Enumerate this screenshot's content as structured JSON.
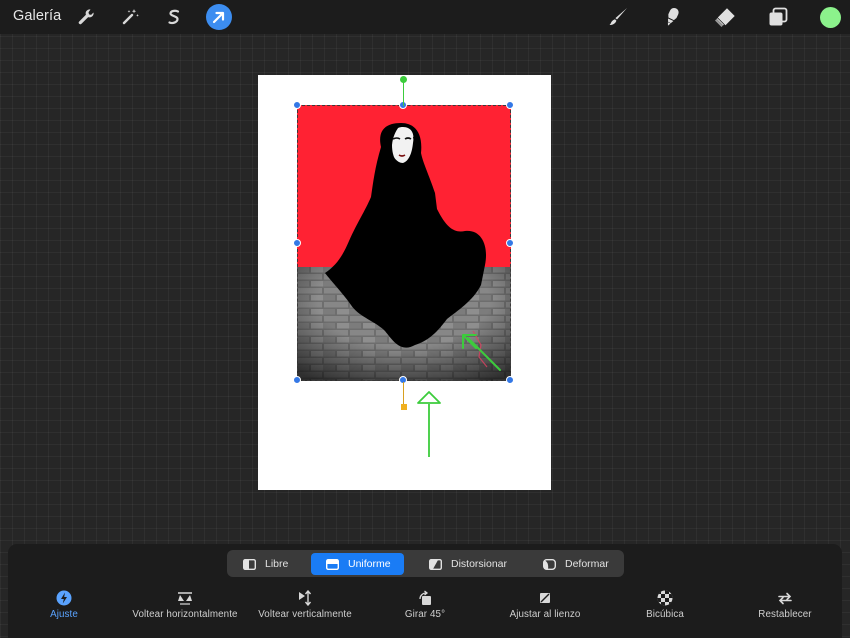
{
  "app": {
    "gallery_label": "Galería"
  },
  "toolbar_left": [
    {
      "name": "actions-wrench-icon"
    },
    {
      "name": "adjustments-magic-wand-icon"
    },
    {
      "name": "selection-icon"
    },
    {
      "name": "transform-arrow-icon",
      "active": true
    }
  ],
  "toolbar_right": [
    {
      "name": "brush-icon"
    },
    {
      "name": "smudge-icon"
    },
    {
      "name": "eraser-icon"
    },
    {
      "name": "layers-icon"
    }
  ],
  "colors": {
    "accent": "#1a7cf5",
    "current_color": "#8cf28c",
    "background_red": "#ff2233",
    "annotation_green": "#3ccc3c",
    "pivot_orange": "#f0b020"
  },
  "transform_modes": [
    {
      "label": "Libre",
      "icon": "freeform-icon",
      "active": false
    },
    {
      "label": "Uniforme",
      "icon": "uniform-icon",
      "active": true
    },
    {
      "label": "Distorsionar",
      "icon": "distort-icon",
      "active": false
    },
    {
      "label": "Deformar",
      "icon": "warp-icon",
      "active": false
    }
  ],
  "transform_tools": [
    {
      "label": "Ajuste",
      "icon": "snapping-lightning-icon",
      "active": true
    },
    {
      "label": "Voltear horizontalmente",
      "icon": "flip-horizontal-icon"
    },
    {
      "label": "Voltear verticalmente",
      "icon": "flip-vertical-icon"
    },
    {
      "label": "Girar 45°",
      "icon": "rotate-45-icon"
    },
    {
      "label": "Ajustar al lienzo",
      "icon": "fit-to-canvas-icon"
    },
    {
      "label": "Bicúbica",
      "icon": "bicubic-icon"
    },
    {
      "label": "Restablecer",
      "icon": "reset-icon"
    }
  ]
}
